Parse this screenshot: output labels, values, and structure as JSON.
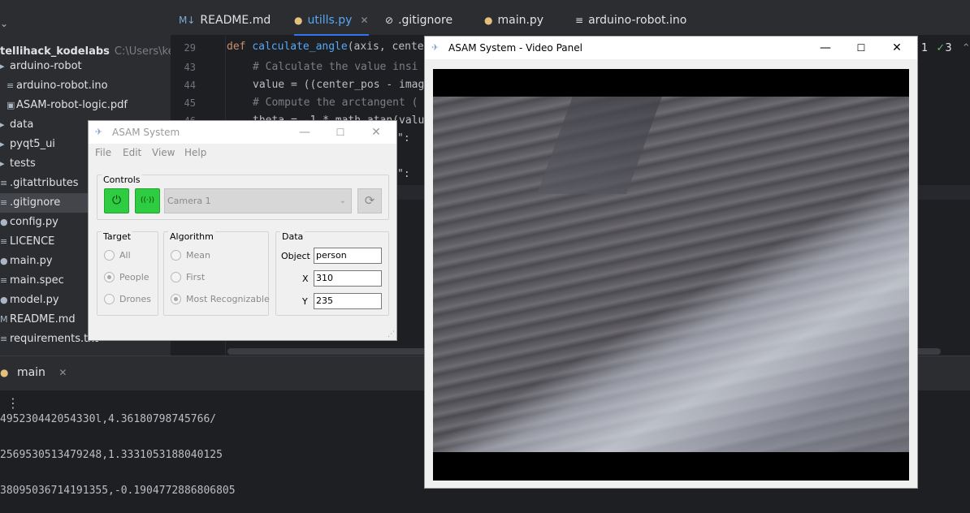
{
  "ide": {
    "project_root": "tellihack_kodelabs",
    "project_path": "C:\\Users\\kenu",
    "tree": [
      {
        "label": "arduino-robot",
        "icon": "folder-icon"
      },
      {
        "label": "arduino-robot.ino",
        "icon": "file-icon"
      },
      {
        "label": "ASAM-robot-logic.pdf",
        "icon": "pdf-icon"
      },
      {
        "label": "data",
        "icon": "folder-icon"
      },
      {
        "label": "pyqt5_ui",
        "icon": "folder-icon"
      },
      {
        "label": "tests",
        "icon": "folder-icon"
      },
      {
        "label": ".gitattributes",
        "icon": "file-icon"
      },
      {
        "label": ".gitignore",
        "icon": "file-icon"
      },
      {
        "label": "config.py",
        "icon": "python-icon"
      },
      {
        "label": "LICENCE",
        "icon": "file-icon"
      },
      {
        "label": "main.py",
        "icon": "python-icon"
      },
      {
        "label": "main.spec",
        "icon": "file-icon"
      },
      {
        "label": "model.py",
        "icon": "python-icon"
      },
      {
        "label": "README.md",
        "icon": "markdown-icon"
      },
      {
        "label": "requirements.txt",
        "icon": "file-icon"
      }
    ],
    "tabs": [
      {
        "label": "README.md",
        "icon_text": "M↓"
      },
      {
        "label": "utills.py",
        "icon_text": "●"
      },
      {
        "label": ".gitignore",
        "icon_text": "⊘"
      },
      {
        "label": "main.py",
        "icon_text": "●"
      },
      {
        "label": "arduino-robot.ino",
        "icon_text": "≡"
      }
    ],
    "line_numbers": [
      "29",
      "43",
      "44",
      "45",
      "46"
    ],
    "code": {
      "line1_kw": "def ",
      "line1_fn": "calculate_angle",
      "line1_rest": "(axis, cente",
      "line2": "# Calculate the value insi",
      "line3": "value = ((center_pos - imag",
      "line4": "# Compute the arctangent (",
      "line5": "theta = -1 * math.atan(valu",
      "line6": "\":",
      "line7": "\":"
    },
    "inspections": {
      "warn": "1",
      "ok": "3"
    },
    "run": {
      "tab_label": "main",
      "menu": "⋮",
      "output": [
        "495230442054330l,4.36180798745766/",
        "2569530513479248,1.3331053188040125",
        "38095036714191355,-0.1904772886806805"
      ]
    }
  },
  "asam_window": {
    "title": "ASAM System",
    "menu": [
      "File",
      "Edit",
      "View",
      "Help"
    ],
    "controls": {
      "group_title": "Controls",
      "power_glyph": "⏻",
      "signal_glyph": "((·))",
      "camera_selected": "Camera 1",
      "refresh_glyph": "⟳"
    },
    "target": {
      "title": "Target",
      "options": [
        "All",
        "People",
        "Drones"
      ],
      "selected": "People"
    },
    "algorithm": {
      "title": "Algorithm",
      "options": [
        "Mean",
        "First",
        "Most Recognizable"
      ],
      "selected": "Most Recognizable"
    },
    "data": {
      "title": "Data",
      "object_label": "Object",
      "object_value": "person",
      "x_label": "X",
      "x_value": "310",
      "y_label": "Y",
      "y_value": "235"
    }
  },
  "video_window": {
    "title": "ASAM System - Video Panel"
  },
  "colors": {
    "ide_bg": "#1e1f22",
    "ide_panel": "#2b2d30",
    "accent_blue": "#3574f0",
    "green_button": "#2ecc40"
  }
}
